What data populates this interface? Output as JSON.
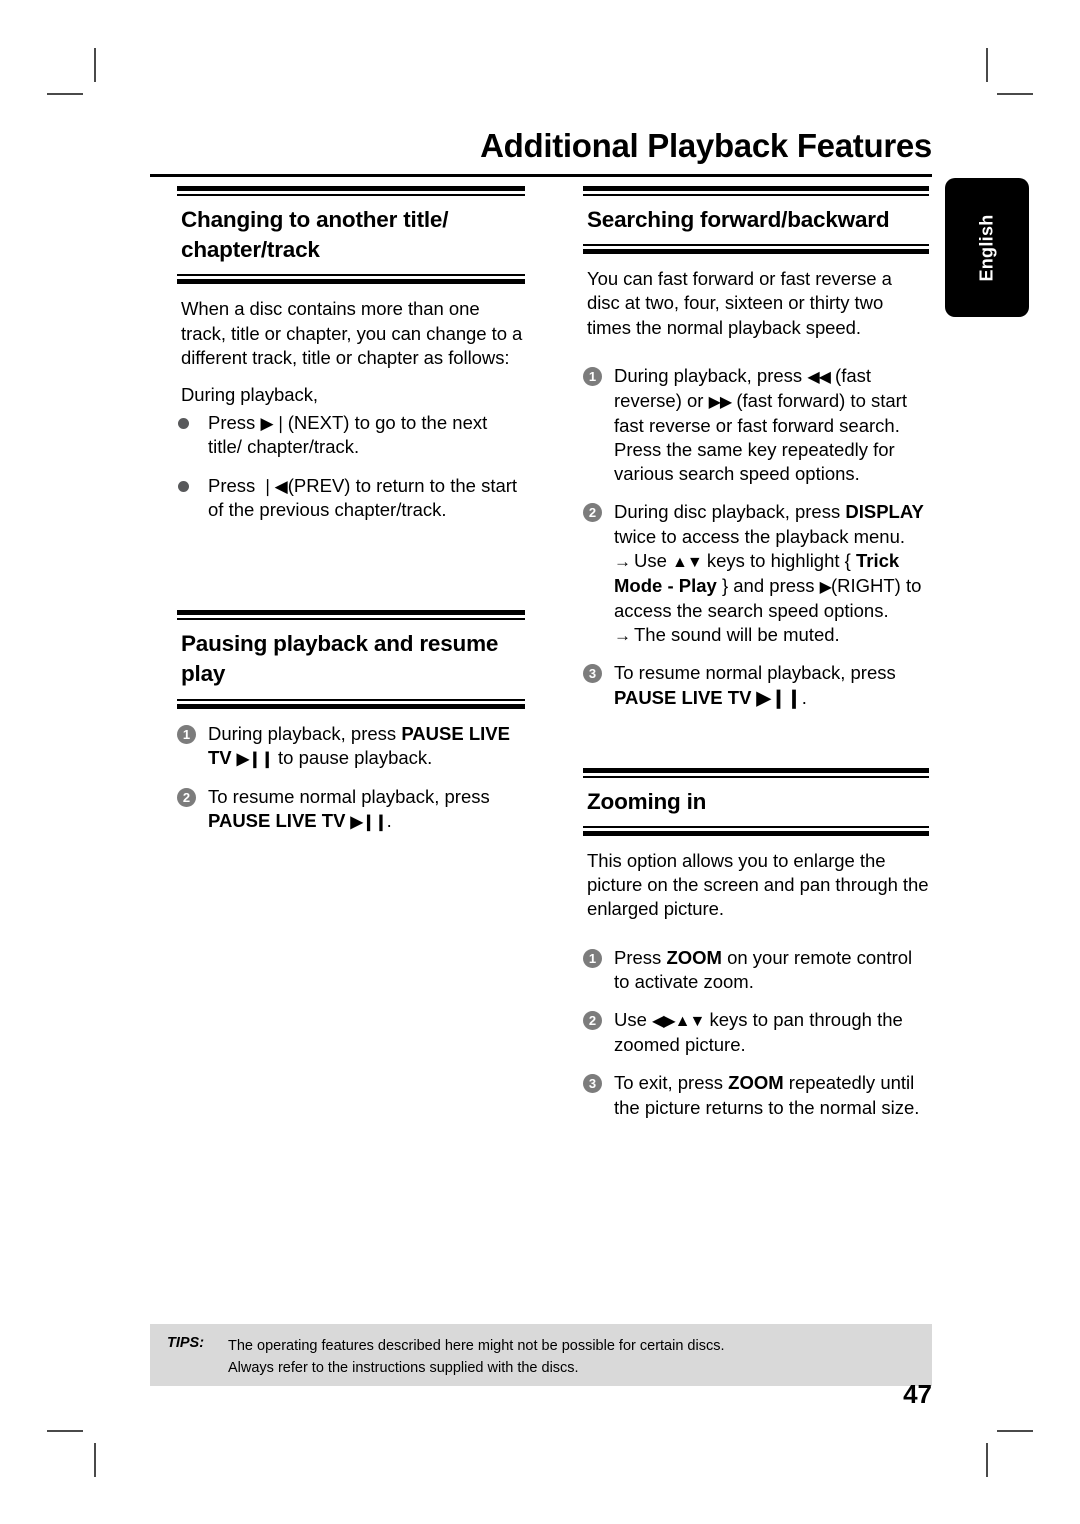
{
  "page": {
    "title": "Additional Playback Features",
    "number": "47",
    "language_tab": "English"
  },
  "left_column": {
    "section1": {
      "heading": "Changing to another title/ chapter/track",
      "intro": "When a disc contains more than one track, title or chapter, you can change to a different track, title or chapter as follows:",
      "lead_in": "During playback,",
      "bullets": [
        {
          "pre": "Press ",
          "glyph": "▶❘",
          "post": "(NEXT) to go to the next title/ chapter/track."
        },
        {
          "pre": "Press ",
          "glyph": "❘◀",
          "post": "(PREV) to return to the start of the previous chapter/track."
        }
      ]
    },
    "section2": {
      "heading": "Pausing playback and resume play",
      "steps": [
        {
          "num": "1",
          "parts": [
            {
              "text": "During playback, press ",
              "bold": false
            },
            {
              "text": "PAUSE LIVE TV ",
              "bold": true
            },
            {
              "text": "▶❙❙",
              "bold": true
            },
            {
              "text": " to pause playback.",
              "bold": false
            }
          ]
        },
        {
          "num": "2",
          "parts": [
            {
              "text": "To resume normal playback, press ",
              "bold": false
            },
            {
              "text": "PAUSE LIVE TV ",
              "bold": true
            },
            {
              "text": "▶❙❙",
              "bold": true
            },
            {
              "text": ".",
              "bold": false
            }
          ]
        }
      ]
    }
  },
  "right_column": {
    "section1": {
      "heading": "Searching forward/backward",
      "intro": "You can fast forward or fast reverse a disc at two, four, sixteen or thirty two times the normal playback speed.",
      "steps": [
        {
          "num": "1",
          "text_before": "During playback, press ",
          "glyph_rev": "◀◀",
          "text_mid": " (fast reverse) or ",
          "glyph_fwd": "▶▶",
          "text_after": " (fast forward) to start fast reverse or fast forward search. Press the same key repeatedly for various search speed options."
        },
        {
          "num": "2",
          "text_before": "During disc playback, press ",
          "bold_key": "DISPLAY",
          "text_after": " twice to access the playback menu.",
          "sub1_pre": "Use ",
          "sub1_glyph": "▲▼",
          "sub1_mid": " keys to highlight { ",
          "sub1_bold": "Trick Mode - Play",
          "sub1_mid2": " } and press ",
          "sub1_glyph2": "▶",
          "sub1_post": "(RIGHT) to access the search speed options.",
          "sub2": "The sound will be muted."
        },
        {
          "num": "3",
          "text_before": "To resume normal playback, press ",
          "bold_key": "PAUSE LIVE TV ▶❙❙",
          "text_after": "."
        }
      ]
    },
    "section2": {
      "heading": "Zooming in",
      "intro": "This option allows you to enlarge the picture on the screen and pan through the enlarged picture.",
      "steps": [
        {
          "num": "1",
          "text_before": "Press ",
          "bold_key": "ZOOM",
          "text_after": " on your remote control to activate zoom."
        },
        {
          "num": "2",
          "text_before": "Use ",
          "glyph": "◀▶▲▼",
          "text_after": " keys to pan through the zoomed picture."
        },
        {
          "num": "3",
          "text_before": "To exit, press ",
          "bold_key": "ZOOM",
          "text_after": " repeatedly until the picture returns to the normal size."
        }
      ]
    }
  },
  "tips": {
    "label": "TIPS:",
    "line1": "The operating features described here might not be possible for certain discs.",
    "line2": "Always refer to the instructions supplied with the discs."
  },
  "colors": {
    "tips_background": "#d9d9d9",
    "number_badge": "#7c7c7c",
    "bullet": "#58595b",
    "tab_background": "#000000"
  }
}
